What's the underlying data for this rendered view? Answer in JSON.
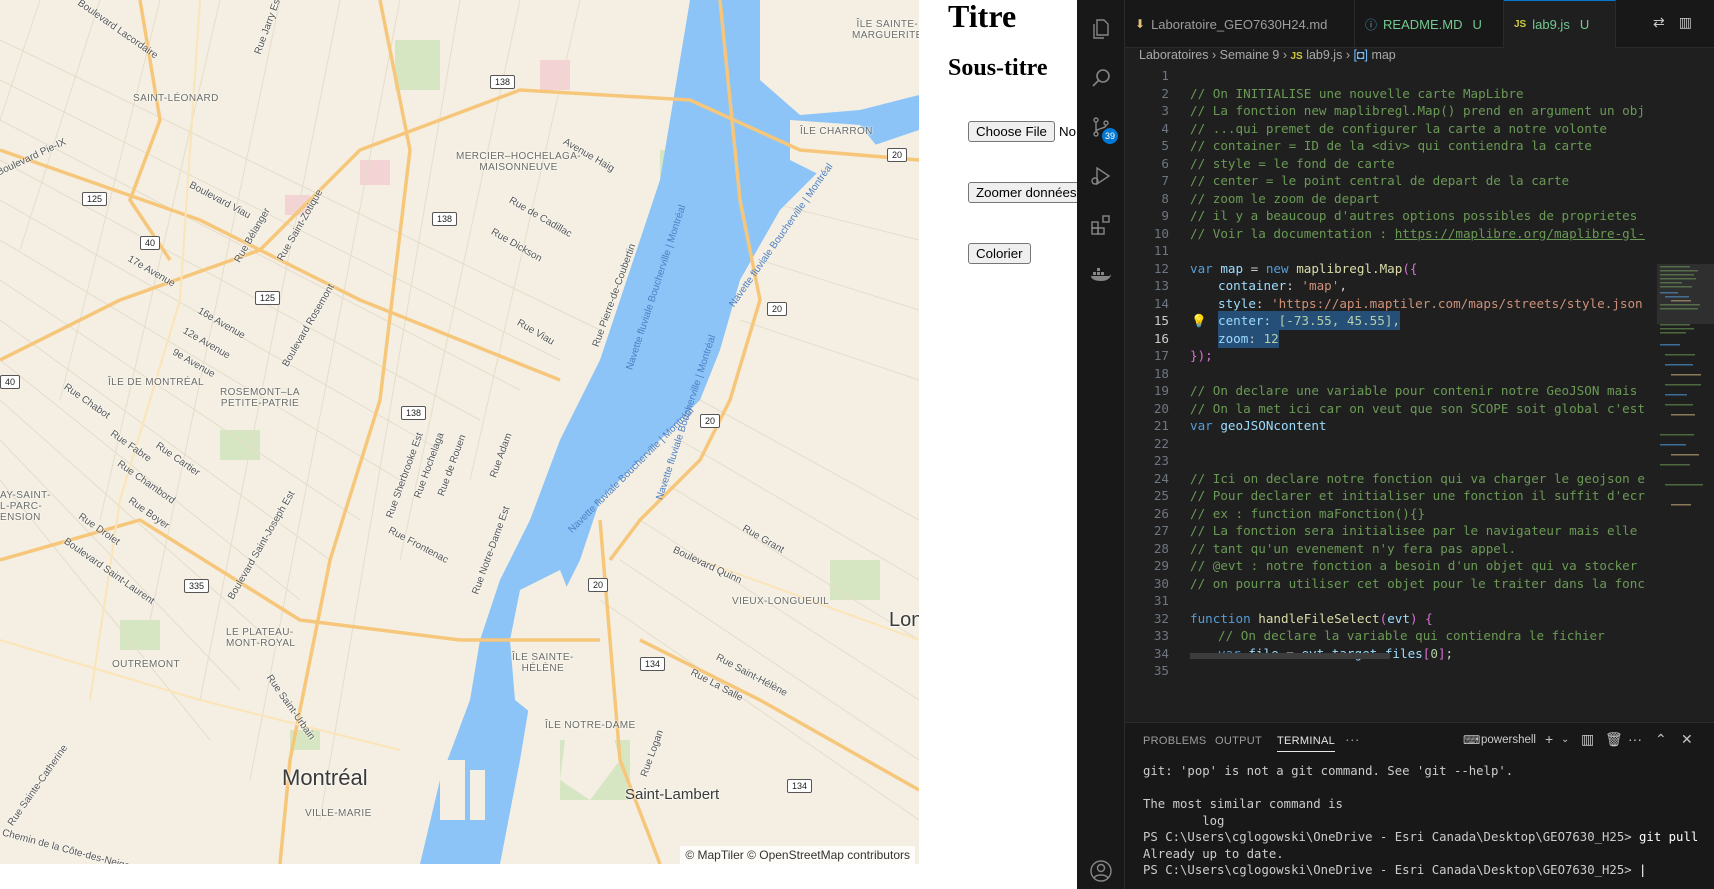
{
  "browser": {
    "title": "Titre",
    "subtitle": "Sous-titre",
    "file_button": "Choose File",
    "file_status": "No",
    "zoom_button": "Zoomer données",
    "color_button": "Colorier",
    "map": {
      "attribution": "© MapTiler © OpenStreetMap contributors",
      "colors": {
        "water": "#8cc4f7",
        "land": "#f4efe2",
        "road_major": "#f6c77a",
        "park": "#d7e6c2"
      },
      "labels": {
        "montreal": "Montréal",
        "saint_lambert": "Saint-Lambert",
        "longueuil_partial": "Lon",
        "ile_sainte_marguerite": "ÎLE SAINTE-\nMARGUERITE",
        "ile_charron": "ÎLE CHARRON",
        "saint_leonard": "SAINT-LÉONARD",
        "mercier": "MERCIER–HOCHELAGA-\nMAISONNEUVE",
        "ile_de_montreal": "ÎLE DE MONTRÉAL",
        "rosemont": "ROSEMONT–LA\nPETITE-PATRIE",
        "vieux_longueuil": "VIEUX-LONGUEUIL",
        "plateau": "LE PLATEAU-\nMONT-ROYAL",
        "outremont": "OUTREMONT",
        "ile_sainte_helene": "ÎLE SAINTE-\nHÉLÈNE",
        "ile_notre_dame": "ÎLE NOTRE-DAME",
        "ville_marie": "VILLE-MARIE",
        "ahuntsic_partial": "AY-SAINT-\nL-PARC-\nENSION",
        "boulevard_lacordaire": "Boulevard Lacordaire",
        "boulevard_pie_ix": "Boulevard Pie-IX",
        "boulevard_viau": "Boulevard Viau",
        "rue_belanger": "Rue Bélanger",
        "rue_saint_zotique": "Rue Saint-Zotique",
        "avenue_17e": "17e Avenue",
        "avenue_16e": "16e Avenue",
        "avenue_12e": "12e Avenue",
        "avenue_9e": "9e Avenue",
        "boulevard_rosemont": "Boulevard Rosemont",
        "rue_chabot": "Rue Chabot",
        "rue_fabre": "Rue Fabre",
        "rue_cartier": "Rue Cartier",
        "rue_chambord": "Rue Chambord",
        "rue_boyer": "Rue Boyer",
        "rue_drolet": "Rue Drolet",
        "boulevard_saint_laurent": "Boulevard Saint-Laurent",
        "boulevard_saint_joseph": "Boulevard Saint-Joseph Est",
        "rue_sherbrooke": "Rue Sherbrooke Est",
        "rue_hochelaga": "Rue Hochelaga",
        "rue_de_rouen": "Rue de Rouen",
        "rue_adam": "Rue Adam",
        "rue_frontenac": "Rue Frontenac",
        "rue_notre_dame": "Rue Notre-Dame Est",
        "avenue_haig": "Avenue Haig",
        "rue_de_cadillac": "Rue de Cadillac",
        "rue_dickson": "Rue Dickson",
        "rue_viau": "Rue Viau",
        "rue_pierre_de_coubertin": "Rue Pierre-de-Coubertin",
        "rue_grant": "Rue Grant",
        "boulevard_quinn": "Boulevard Quinn",
        "rue_saint_helene": "Rue Saint-Hélène",
        "rue_la_salle": "Rue La Salle",
        "rue_logan": "Rue Logan",
        "rue_saint_urbain": "Rue Saint-Urbain",
        "rue_sainte_catherine": "Rue Sainte-Catherine",
        "chemin_cote_des_neiges": "Chemin de la Côte-des-Neiges",
        "rue_jarry": "Rue Jarry Est",
        "navette_1": "Navette fluviale Boucherville | Montréal",
        "navette_2": "Navette fluviale Boucherville | Montréal",
        "navette_3": "Navette fluviale Boucherville | Montréal",
        "navette_4": "Navette fluviale Boucherville | Montréal"
      },
      "shields": [
        "138",
        "125",
        "138",
        "40",
        "125",
        "40",
        "138",
        "335",
        "20",
        "20",
        "20",
        "20",
        "134",
        "134"
      ]
    }
  },
  "vscode": {
    "tabs": [
      {
        "label": "Laboratoire_GEO7630H24.md",
        "status": ""
      },
      {
        "label": "README.MD",
        "status": "U"
      },
      {
        "label": "lab9.js",
        "status": "U"
      }
    ],
    "breadcrumb": [
      "Laboratoires",
      "Semaine 9",
      "lab9.js",
      "map"
    ],
    "scm_badge": "39",
    "lines": [
      "1",
      "2",
      "3",
      "4",
      "5",
      "6",
      "7",
      "8",
      "9",
      "10",
      "11",
      "12",
      "13",
      "14",
      "15",
      "16",
      "17",
      "18",
      "19",
      "20",
      "21",
      "22",
      "23",
      "24",
      "25",
      "26",
      "27",
      "28",
      "29",
      "30",
      "31",
      "32",
      "33",
      "34",
      "35"
    ],
    "code": {
      "l2": "// On INITIALISE une nouvelle carte MapLibre",
      "l3": "// La fonction new maplibregl.Map() prend en argument un obj",
      "l4": "// ...qui premet de configurer la carte a notre volonte",
      "l5": "// container = ID de la <div> qui contiendra la carte",
      "l6": "// style = le fond de carte",
      "l7": "// center = le point central de depart de la carte",
      "l8": "// zoom le zoom de depart",
      "l9": "// il y a beaucoup d'autres options possibles de proprietes",
      "l10_prefix": "// Voir la documentation : ",
      "l10_link": "https://maplibre.org/maplibre-gl-",
      "l12_var": "var",
      "l12_name": "map",
      "l12_eq": " = ",
      "l12_new": "new",
      "l12_call": "maplibregl.Map",
      "l12_end": "({",
      "l13_key": "container",
      "l13_val": "'map'",
      "l14_key": "style",
      "l14_val": "'https://api.maptiler.com/maps/streets/style.json",
      "l15_key": "center",
      "l15_val": "[-73.55, 45.55],",
      "l16_key": "zoom",
      "l16_val": "12",
      "l17": "});",
      "l19": "// On declare une variable pour contenir notre GeoJSON mais",
      "l20": "// On la met ici car on veut que son SCOPE soit global c'est",
      "l21_var": "var",
      "l21_name": "geoJSONcontent",
      "l24": "// Ici on declare notre fonction qui va charger le geojson e",
      "l25": "// Pour declarer et initialiser une fonction il suffit d'ecr",
      "l26": "// ex : function maFonction(){}",
      "l27": "// La fonction sera initialisee par le navigateur mais elle",
      "l28": "// tant qu'un evenement n'y fera pas appel.",
      "l29": "// @evt : notre fonction a besoin d'un objet qui va stocker",
      "l30": "// on pourra utiliser cet objet pour le traiter dans la fonc",
      "l32_kw": "function",
      "l32_name": "handleFileSelect",
      "l32_arg": "evt",
      "l33": "// On declare la variable qui contiendra le fichier",
      "l34_var": "var",
      "l34_name": "file",
      "l34_rhs": "evt.target.files",
      "l34_idx": "0"
    },
    "panel": {
      "tabs": [
        "PROBLEMS",
        "OUTPUT",
        "TERMINAL"
      ],
      "active": "TERMINAL",
      "shell": "powershell",
      "terminal": [
        "git: 'pop' is not a git command. See 'git --help'.",
        "",
        "The most similar command is",
        "        log",
        "PS C:\\Users\\cglogowski\\OneDrive - Esri Canada\\Desktop\\GEO7630_H25> ",
        "Already up to date.",
        "PS C:\\Users\\cglogowski\\OneDrive - Esri Canada\\Desktop\\GEO7630_H25> "
      ],
      "cmd_git_pull": "git pull",
      "cursor": "|"
    }
  }
}
